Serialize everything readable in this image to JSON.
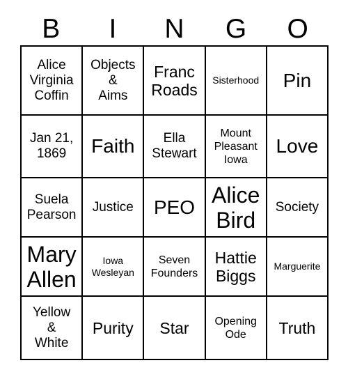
{
  "card": {
    "title": "BINGO",
    "headers": [
      "B",
      "I",
      "N",
      "G",
      "O"
    ],
    "rows": [
      [
        {
          "text": "Alice\nVirginia\nCoffin",
          "size": "sm"
        },
        {
          "text": "Objects\n&\nAims",
          "size": "sm"
        },
        {
          "text": "Franc\nRoads",
          "size": "md"
        },
        {
          "text": "Sisterhood",
          "size": "xxs"
        },
        {
          "text": "Pin",
          "size": "lg"
        }
      ],
      [
        {
          "text": "Jan 21,\n1869",
          "size": "sm"
        },
        {
          "text": "Faith",
          "size": "lg"
        },
        {
          "text": "Ella\nStewart",
          "size": "sm"
        },
        {
          "text": "Mount\nPleasant\nIowa",
          "size": "xs"
        },
        {
          "text": "Love",
          "size": "lg"
        }
      ],
      [
        {
          "text": "Suela\nPearson",
          "size": "sm"
        },
        {
          "text": "Justice",
          "size": "sm"
        },
        {
          "text": "PEO",
          "size": "lg"
        },
        {
          "text": "Alice\nBird",
          "size": "xl"
        },
        {
          "text": "Society",
          "size": "sm"
        }
      ],
      [
        {
          "text": "Mary\nAllen",
          "size": "xl"
        },
        {
          "text": "Iowa\nWesleyan",
          "size": "xxs"
        },
        {
          "text": "Seven\nFounders",
          "size": "xs"
        },
        {
          "text": "Hattie\nBiggs",
          "size": "md"
        },
        {
          "text": "Marguerite",
          "size": "xxs"
        }
      ],
      [
        {
          "text": "Yellow\n&\nWhite",
          "size": "sm"
        },
        {
          "text": "Purity",
          "size": "md"
        },
        {
          "text": "Star",
          "size": "md"
        },
        {
          "text": "Opening\nOde",
          "size": "xs"
        },
        {
          "text": "Truth",
          "size": "md"
        }
      ]
    ]
  }
}
